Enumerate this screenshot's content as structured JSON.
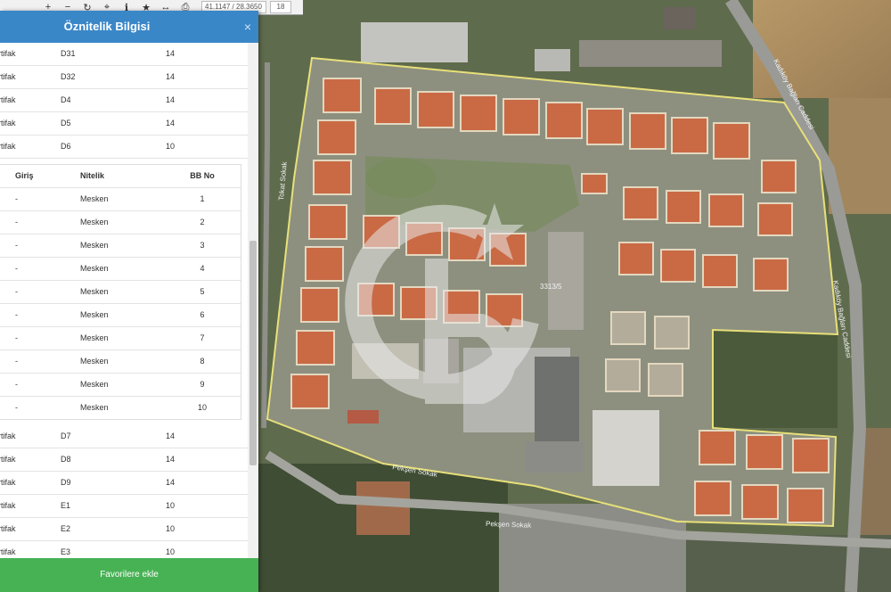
{
  "panel": {
    "title": "Öznitelik Bilgisi",
    "close_symbol": "×",
    "rows_top": [
      {
        "kind": "rtifak",
        "block": "D31",
        "count": "14"
      },
      {
        "kind": "rtifak",
        "block": "D32",
        "count": "14"
      },
      {
        "kind": "rtifak",
        "block": "D4",
        "count": "14"
      },
      {
        "kind": "rtifak",
        "block": "D5",
        "count": "14"
      },
      {
        "kind": "rtifak",
        "block": "D6",
        "count": "10"
      }
    ],
    "sub_table": {
      "headers": {
        "giris": "Giriş",
        "nitelik": "Nitelik",
        "bb_no": "BB No"
      },
      "rows": [
        {
          "giris": "-",
          "nitelik": "Mesken",
          "bb_no": "1"
        },
        {
          "giris": "-",
          "nitelik": "Mesken",
          "bb_no": "2"
        },
        {
          "giris": "-",
          "nitelik": "Mesken",
          "bb_no": "3"
        },
        {
          "giris": "-",
          "nitelik": "Mesken",
          "bb_no": "4"
        },
        {
          "giris": "-",
          "nitelik": "Mesken",
          "bb_no": "5"
        },
        {
          "giris": "-",
          "nitelik": "Mesken",
          "bb_no": "6"
        },
        {
          "giris": "-",
          "nitelik": "Mesken",
          "bb_no": "7"
        },
        {
          "giris": "-",
          "nitelik": "Mesken",
          "bb_no": "8"
        },
        {
          "giris": "-",
          "nitelik": "Mesken",
          "bb_no": "9"
        },
        {
          "giris": "-",
          "nitelik": "Mesken",
          "bb_no": "10"
        }
      ]
    },
    "rows_bottom": [
      {
        "kind": "rtifak",
        "block": "D7",
        "count": "14"
      },
      {
        "kind": "rtifak",
        "block": "D8",
        "count": "14"
      },
      {
        "kind": "rtifak",
        "block": "D9",
        "count": "14"
      },
      {
        "kind": "rtifak",
        "block": "E1",
        "count": "10"
      },
      {
        "kind": "rtifak",
        "block": "E2",
        "count": "10"
      },
      {
        "kind": "rtifak",
        "block": "E3",
        "count": "10"
      }
    ],
    "favorite_button": "Favorilere ekle"
  },
  "toolbar": {
    "icons": [
      "plus-icon",
      "minus-icon",
      "refresh-icon",
      "locate-icon",
      "info-icon",
      "star-icon",
      "measure-icon",
      "print-icon"
    ],
    "coordinates": "41.1147 / 28.3650",
    "zoom": "18"
  },
  "map": {
    "street_labels": [
      "Tokat Sokak",
      "Kadıköy Bağları Caddesi",
      "Kadıköy Bağları Caddesi",
      "Pekşen Sokak",
      "Pekşen Sokak"
    ],
    "parcel_label": "3313/5"
  },
  "colors": {
    "header": "#3a87c8",
    "favorite": "#47b254",
    "parcel_outline": "#e8e07a",
    "roof": "#c96a45"
  }
}
